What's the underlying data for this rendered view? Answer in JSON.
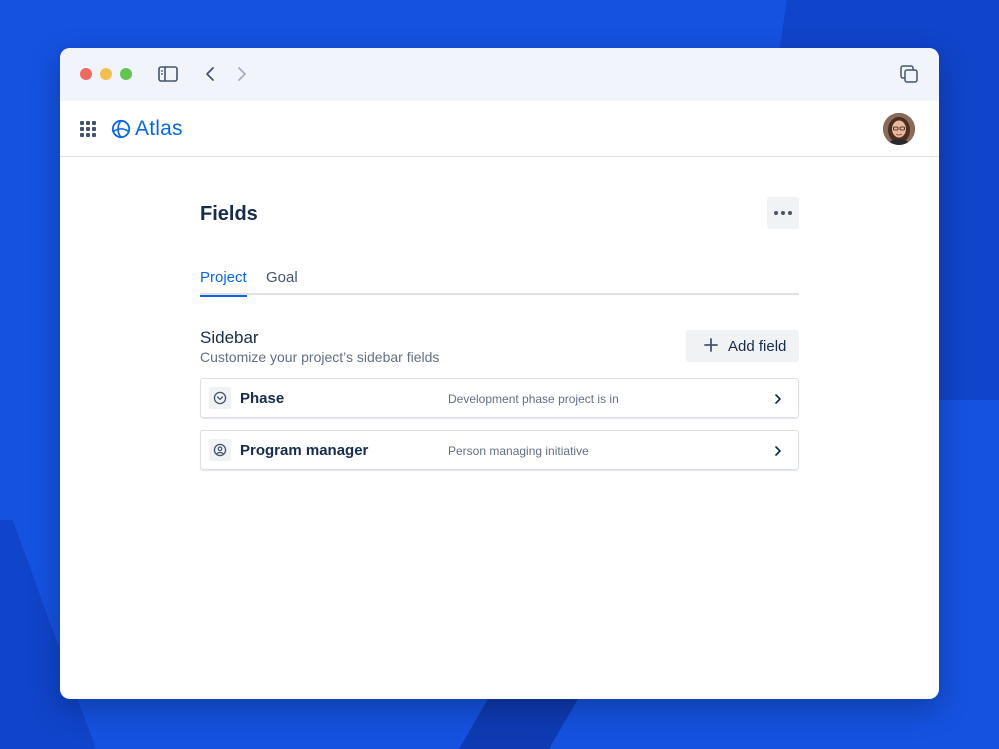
{
  "app": {
    "name": "Atlas"
  },
  "page": {
    "title": "Fields"
  },
  "tabs": [
    {
      "label": "Project",
      "active": true
    },
    {
      "label": "Goal",
      "active": false
    }
  ],
  "section": {
    "title": "Sidebar",
    "subtitle": "Customize your project’s sidebar fields",
    "add_button_label": "Add field"
  },
  "fields": [
    {
      "name": "Phase",
      "description": "Development phase project is in",
      "icon": "chevron-circle-icon"
    },
    {
      "name": "Program manager",
      "description": "Person managing initiative",
      "icon": "user-circle-icon"
    }
  ],
  "colors": {
    "accent": "#0c66e4",
    "background": "#1552e0",
    "text": "#172b4d",
    "subtle_text": "#626f86"
  }
}
